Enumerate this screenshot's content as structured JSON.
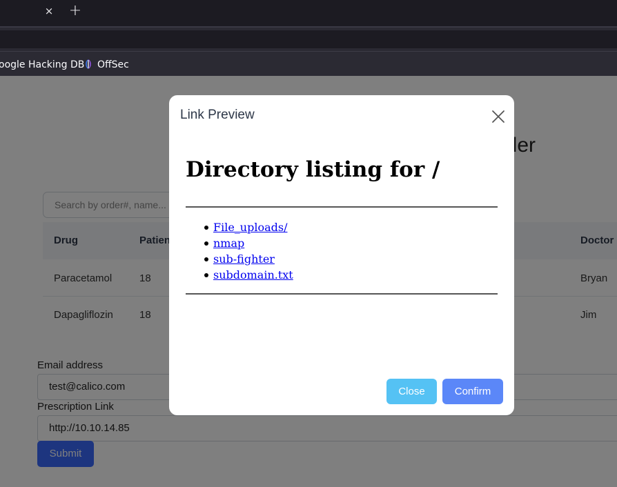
{
  "browser": {
    "tab_close_glyph": "×",
    "new_tab_glyph": "+",
    "bookmarks": [
      {
        "label": "oogle Hacking DB"
      },
      {
        "label": "OffSec",
        "icon": "offsec-icon"
      }
    ]
  },
  "page": {
    "title_partial": "uler",
    "search_placeholder": "Search by order#, name...",
    "table": {
      "columns": [
        "Drug",
        "Patien",
        "Doctor"
      ],
      "rows": [
        {
          "drug": "Paracetamol",
          "patient": "18",
          "doctor": "Bryan"
        },
        {
          "drug": "Dapagliflozin",
          "patient": "18",
          "doctor": "Jim"
        }
      ]
    },
    "form": {
      "email_label": "Email address",
      "email_value": "test@calico.com",
      "link_label": "Prescription Link",
      "link_value": "http://10.10.14.85",
      "submit_label": "Submit"
    }
  },
  "modal": {
    "title": "Link Preview",
    "preview": {
      "heading": "Directory listing for /",
      "items": [
        "File_uploads/",
        "nmap",
        "sub-fighter",
        "subdomain.txt"
      ]
    },
    "close_label": "Close",
    "confirm_label": "Confirm"
  },
  "colors": {
    "close_button": "#55c2f4",
    "confirm_button": "#5b87f8",
    "submit_button": "#3b6bff",
    "link": "#0000ee"
  }
}
